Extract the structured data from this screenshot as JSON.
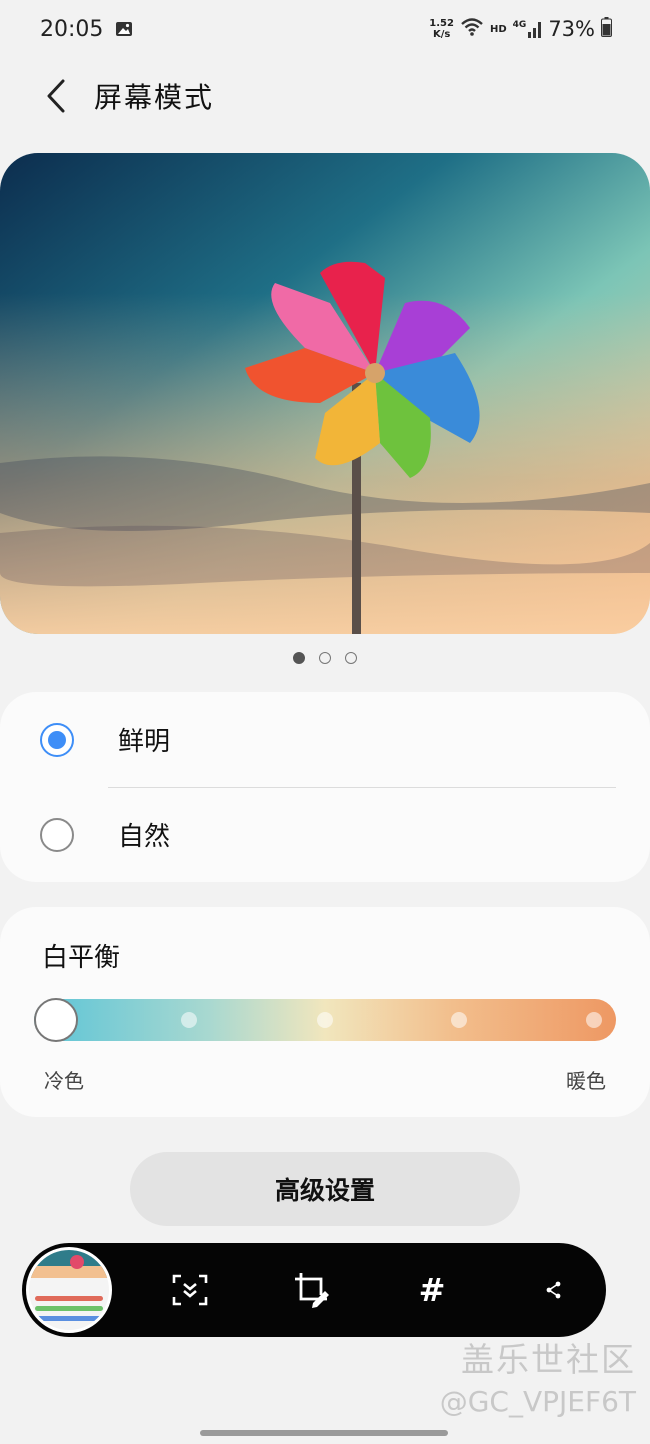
{
  "status_bar": {
    "time": "20:05",
    "net_speed_value": "1.52",
    "net_speed_unit": "K/s",
    "hd": "HD",
    "lte": "4G",
    "battery": "73%"
  },
  "header": {
    "title": "屏幕模式"
  },
  "preview": {
    "pager_count": 3,
    "pager_active": 0
  },
  "mode": {
    "options": [
      {
        "label": "鲜明",
        "selected": true
      },
      {
        "label": "自然",
        "selected": false
      }
    ]
  },
  "white_balance": {
    "title": "白平衡",
    "cool_label": "冷色",
    "warm_label": "暖色",
    "level_fraction": 0.0,
    "steps": 5
  },
  "advanced": {
    "label": "高级设置"
  },
  "toolbar": {
    "hash_label": "#"
  },
  "watermark": {
    "community": "盖乐世社区",
    "user": "@GC_VPJEF6T"
  },
  "colors": {
    "accent": "#3e8ef7",
    "wb_cool": "#5bc4d7",
    "wb_warm": "#ee9863"
  }
}
